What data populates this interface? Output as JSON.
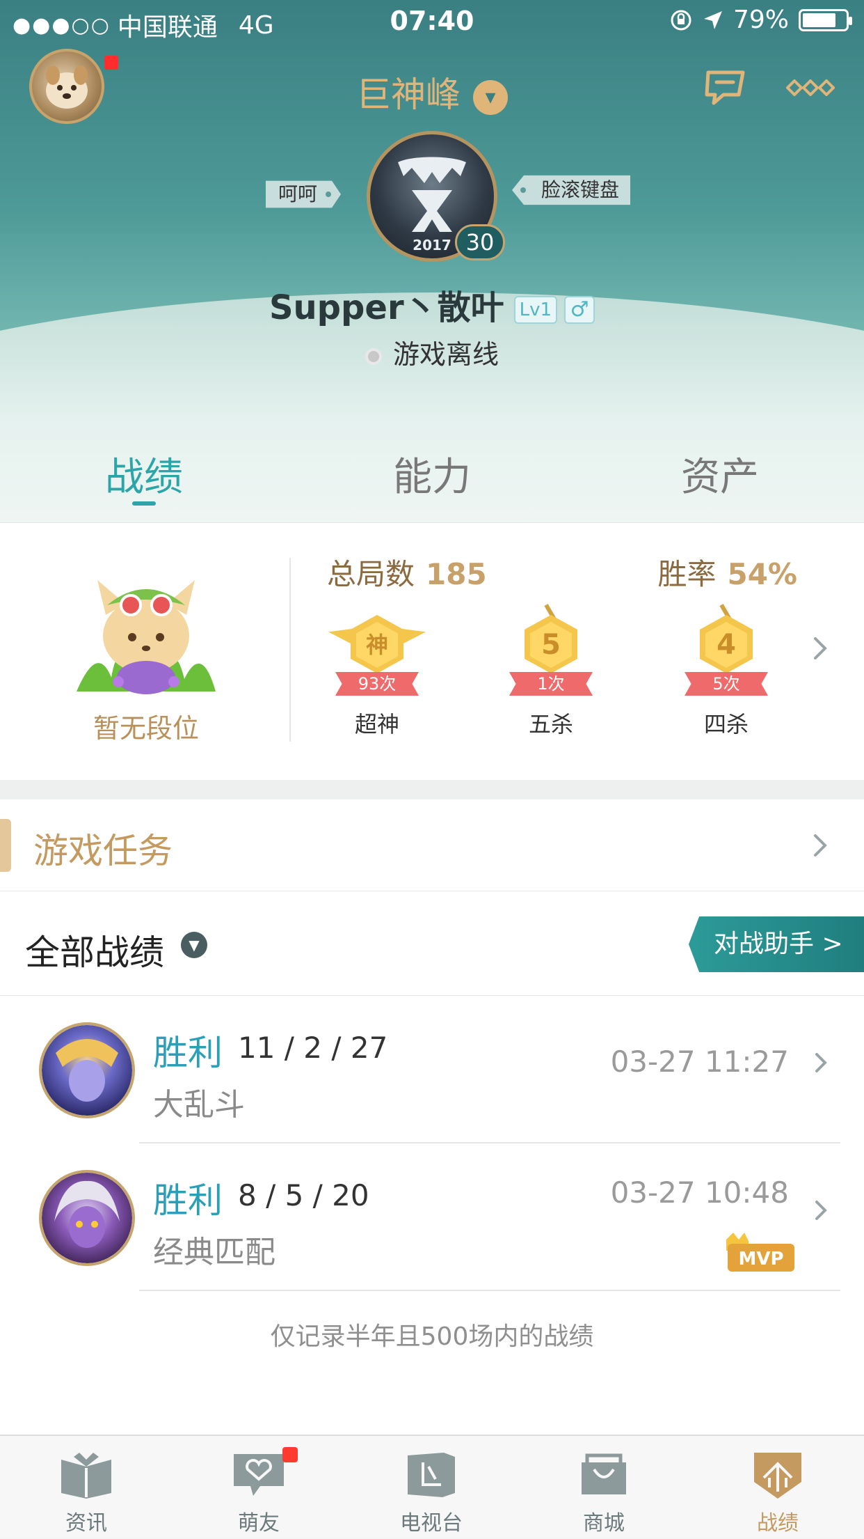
{
  "status_bar": {
    "signal": "●●●○○",
    "carrier": "中国联通",
    "network": "4G",
    "time": "07:40",
    "battery_percent": "79%",
    "battery_level": 0.79
  },
  "header": {
    "server_name": "巨神峰",
    "tag_left": "呵呵",
    "tag_right": "脸滚键盘",
    "emblem_year": "2017",
    "level": "30",
    "player_name": "Supper丶散叶",
    "vip_level": "Lv1",
    "gender_symbol": "♂",
    "online_status": "游戏离线"
  },
  "tabs": [
    {
      "label": "战绩",
      "active": true
    },
    {
      "label": "能力",
      "active": false
    },
    {
      "label": "资产",
      "active": false
    }
  ],
  "stats": {
    "rank_label": "暂无段位",
    "total_games_label": "总局数",
    "total_games_value": "185",
    "winrate_label": "胜率",
    "winrate_value": "54%",
    "medals": [
      {
        "glyph": "神",
        "count": "93次",
        "label": "超神"
      },
      {
        "glyph": "5",
        "count": "1次",
        "label": "五杀"
      },
      {
        "glyph": "4",
        "count": "5次",
        "label": "四杀"
      }
    ]
  },
  "missions": {
    "title": "游戏任务"
  },
  "matches": {
    "title": "全部战绩",
    "assist_button": "对战助手 >",
    "rows": [
      {
        "result": "胜利",
        "kda": "11 / 2 / 27",
        "mode": "大乱斗",
        "time": "03-27 11:27",
        "mvp": false
      },
      {
        "result": "胜利",
        "kda": "8 / 5 / 20",
        "mode": "经典匹配",
        "time": "03-27 10:48",
        "mvp": true
      }
    ],
    "mvp_label": "MVP",
    "footer_note": "仅记录半年且500场内的战绩"
  },
  "bottom_nav": [
    {
      "label": "资讯",
      "icon": "book-icon",
      "active": false,
      "badge": false
    },
    {
      "label": "萌友",
      "icon": "friends-chat-icon",
      "active": false,
      "badge": true
    },
    {
      "label": "电视台",
      "icon": "tv-icon",
      "active": false,
      "badge": false
    },
    {
      "label": "商城",
      "icon": "shop-icon",
      "active": false,
      "badge": false
    },
    {
      "label": "战绩",
      "icon": "record-shield-icon",
      "active": true,
      "badge": false
    }
  ],
  "colors": {
    "accent_teal": "#2ba5a7",
    "gold": "#c49a60",
    "win_blue": "#2a9fb8"
  }
}
